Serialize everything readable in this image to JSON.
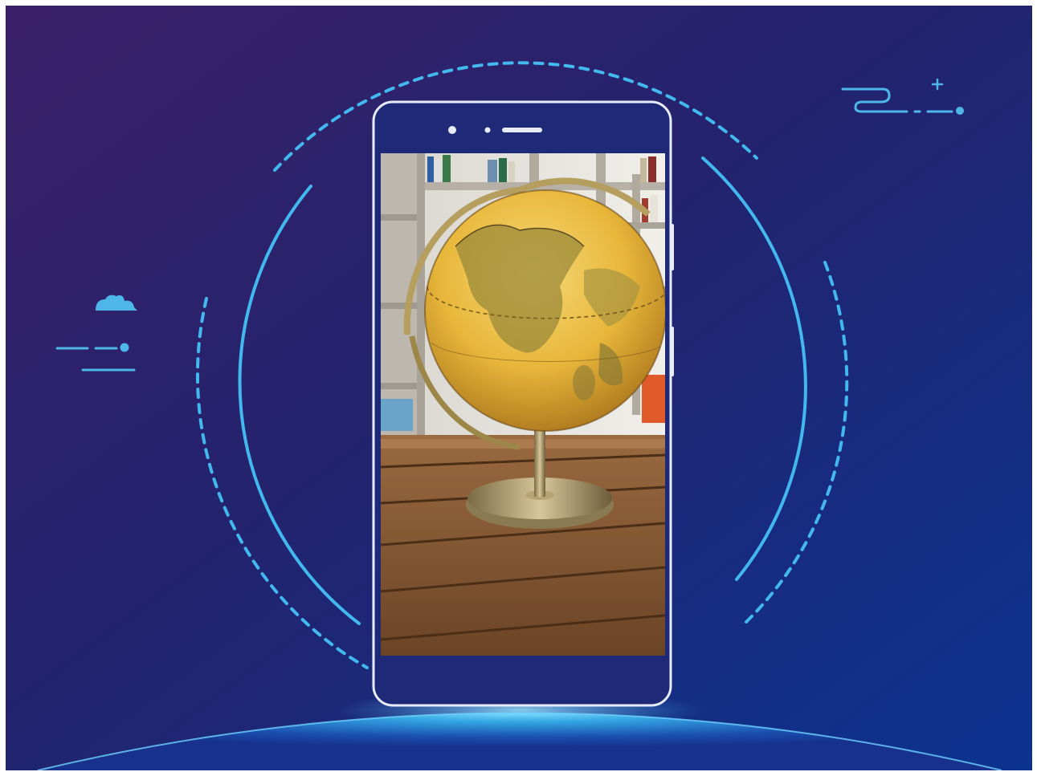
{
  "scene": {
    "subject": "globe-photo-on-phone",
    "colors": {
      "bg_top_left": "#3a2068",
      "bg_mid": "#23236e",
      "bg_bottom_right": "#0b3490",
      "accent": "#42b8ee",
      "phone_outline": "#e8ecf8",
      "planet_glow": "#38b6ee"
    },
    "icons": [
      "cloud-icon",
      "speed-lines-icon",
      "wind-swirl-icon",
      "sparkle-icon"
    ]
  }
}
